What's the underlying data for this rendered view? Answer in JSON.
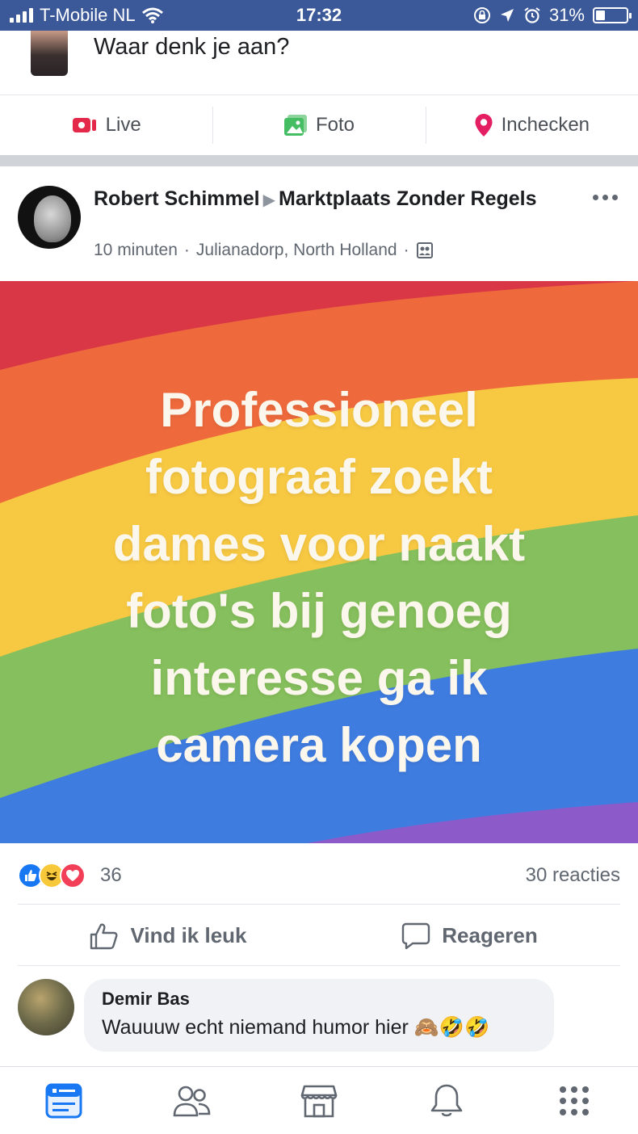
{
  "status_bar": {
    "carrier": "T-Mobile NL",
    "time": "17:32",
    "battery": "31%",
    "battery_level": 0.31
  },
  "composer": {
    "prompt": "Waar denk je aan?",
    "actions": [
      {
        "label": "Live",
        "icon": "live-video-icon"
      },
      {
        "label": "Foto",
        "icon": "photo-icon"
      },
      {
        "label": "Inchecken",
        "icon": "location-pin-icon"
      }
    ]
  },
  "post": {
    "author": "Robert Schimmel",
    "group": "Marktplaats Zonder Regels",
    "time": "10 minuten",
    "location": "Julianadorp, North Holland",
    "image_text_lines": [
      "Professioneel",
      "fotograaf zoekt",
      "dames voor naakt",
      "foto's bij genoeg",
      "interesse ga ik",
      "camera kopen"
    ],
    "reactions_count": "36",
    "comments_count": "30 reacties",
    "buttons": {
      "like": "Vind ik leuk",
      "comment": "Reageren"
    }
  },
  "comment": {
    "author": "Demir Bas",
    "text": "Wauuuw echt niemand humor hier",
    "emojis": "🙈🤣🤣"
  },
  "bottom_nav": [
    "news-feed-icon",
    "friends-icon",
    "marketplace-icon",
    "notifications-icon",
    "menu-icon"
  ],
  "colors": {
    "facebook_blue": "#3b5998",
    "like_blue": "#1877f2",
    "live_red": "#e4284a",
    "photo_green": "#45bd62",
    "pin_pink": "#e41e63"
  }
}
